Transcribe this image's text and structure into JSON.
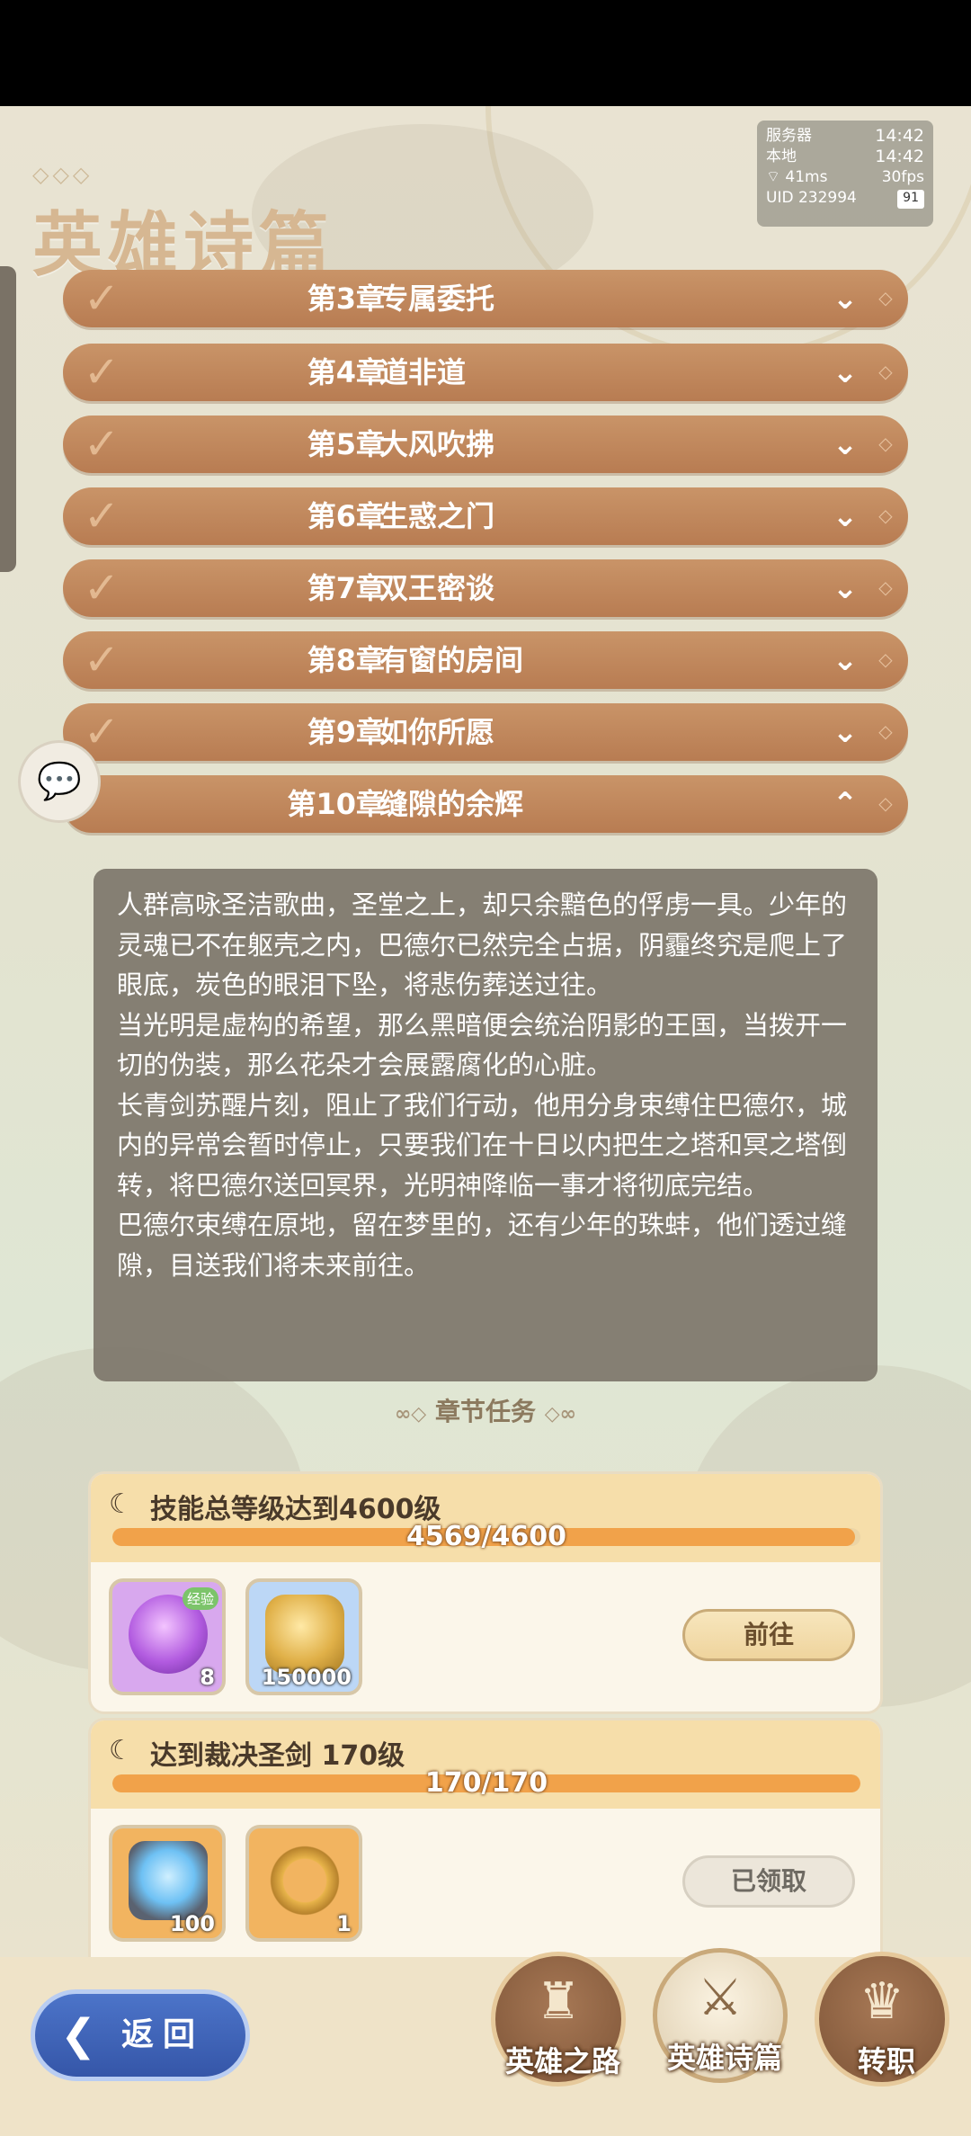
{
  "app": {
    "page_title": "英雄诗篇",
    "ornament": "◇◇◇"
  },
  "status": {
    "server_label": "服务器",
    "server_time": "14:42",
    "local_label": "本地",
    "local_time": "14:42",
    "ping": "41ms",
    "fps": "30fps",
    "uid": "UID 232994",
    "battery": "91"
  },
  "chapters": [
    {
      "num": "第3章",
      "name": "专属委托",
      "completed": true,
      "expanded": false
    },
    {
      "num": "第4章",
      "name": "道非道",
      "completed": true,
      "expanded": false
    },
    {
      "num": "第5章",
      "name": "大风吹拂",
      "completed": true,
      "expanded": false
    },
    {
      "num": "第6章",
      "name": "生惑之门",
      "completed": true,
      "expanded": false
    },
    {
      "num": "第7章",
      "name": "双王密谈",
      "completed": true,
      "expanded": false
    },
    {
      "num": "第8章",
      "name": "有窗的房间",
      "completed": true,
      "expanded": false
    },
    {
      "num": "第9章",
      "name": "如你所愿",
      "completed": true,
      "expanded": false
    },
    {
      "num": "第10章",
      "name": "缝隙的余辉",
      "completed": false,
      "expanded": true
    }
  ],
  "story": {
    "lines": [
      "人群高咏圣洁歌曲，圣堂之上，却只余黯色的俘虏一具。少年的灵魂已不在躯壳之内，巴德尔已然完全占据，阴霾终究是爬上了眼底，炭色的眼泪下坠，将悲伤葬送过往。",
      "当光明是虚构的希望，那么黑暗便会统治阴影的王国，当拨开一切的伪装，那么花朵才会展露腐化的心脏。",
      "长青剑苏醒片刻，阻止了我们行动，他用分身束缚住巴德尔，城内的异常会暂时停止，只要我们在十日以内把生之塔和冥之塔倒转，将巴德尔送回冥界，光明神降临一事才将彻底完结。",
      "巴德尔束缚在原地，留在梦里的，还有少年的珠蚌，他们透过缝隙，目送我们将未来前往。"
    ]
  },
  "section_title": "章节任务",
  "tasks": [
    {
      "title": "技能总等级达到4600级",
      "progress_text": "4569/4600",
      "progress": 0.993,
      "rewards": [
        {
          "icon": "purple-cat-exp-icon",
          "count": "8",
          "badge": "经验",
          "color": "#b25be0"
        },
        {
          "icon": "gold-coin-icon",
          "count": "150000",
          "color": "#6aa6e8"
        }
      ],
      "button": "前往",
      "button_state": "go"
    },
    {
      "title": "达到裁决圣剑 170级",
      "progress_text": "170/170",
      "progress": 1.0,
      "rewards": [
        {
          "icon": "crystal-canister-icon",
          "count": "100",
          "color": "#f0a94a"
        },
        {
          "icon": "gold-ring-icon",
          "count": "1",
          "color": "#f0a94a"
        }
      ],
      "button": "已领取",
      "button_state": "claimed"
    }
  ],
  "bottom_nav": {
    "back": "返回",
    "items": [
      {
        "label": "英雄之路",
        "active": false
      },
      {
        "label": "英雄诗篇",
        "active": true
      },
      {
        "label": "转职",
        "active": false
      }
    ]
  }
}
